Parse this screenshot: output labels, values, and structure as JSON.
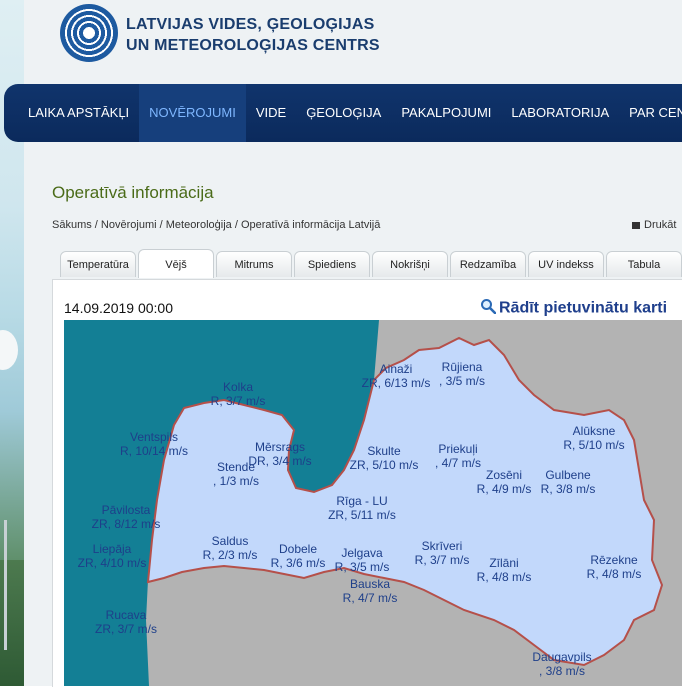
{
  "header": {
    "org_line1": "LATVIJAS VIDES, ĢEOLOĢIJAS",
    "org_line2": "UN METEOROLOĢIJAS CENTRS"
  },
  "nav": {
    "items": [
      {
        "label": "LAIKA APSTĀKĻI",
        "active": false
      },
      {
        "label": "NOVĒROJUMI",
        "active": true
      },
      {
        "label": "VIDE",
        "active": false
      },
      {
        "label": "ĢEOLOĢIJA",
        "active": false
      },
      {
        "label": "PAKALPOJUMI",
        "active": false
      },
      {
        "label": "LABORATORIJA",
        "active": false
      },
      {
        "label": "PAR CENTRU",
        "active": false
      }
    ]
  },
  "page": {
    "title": "Operatīvā informācija",
    "breadcrumb": [
      "Sākums",
      "Novērojumi",
      "Meteoroloģija",
      "Operatīvā informācija Latvijā"
    ],
    "breadcrumb_sep": " / ",
    "print_label": "Drukāt"
  },
  "tabs": [
    {
      "label": "Temperatūra",
      "active": false
    },
    {
      "label": "Vējš",
      "active": true
    },
    {
      "label": "Mitrums",
      "active": false
    },
    {
      "label": "Spiediens",
      "active": false
    },
    {
      "label": "Nokrišņi",
      "active": false
    },
    {
      "label": "Redzamība",
      "active": false
    },
    {
      "label": "UV indekss",
      "active": false
    },
    {
      "label": "Tabula",
      "active": false
    }
  ],
  "map_panel": {
    "date": "14.09.2019 00:00",
    "zoom_link": "Rādīt pietuvinātu karti",
    "icon": "magnifier-icon",
    "colors": {
      "sea": "#137f95",
      "land": "#c2d8fb",
      "neighbor": "#b3b3b3",
      "border": "#b5504a",
      "station_text": "#1e3f8a"
    }
  },
  "stations": [
    {
      "name": "Ainaži",
      "wind": "ZR, 6/13 m/s"
    },
    {
      "name": "Rūjiena",
      "wind": ", 3/5 m/s"
    },
    {
      "name": "Kolka",
      "wind": "R, 3/7 m/s"
    },
    {
      "name": "Ventspils",
      "wind": "R, 10/14 m/s"
    },
    {
      "name": "Mērsrags",
      "wind": "DR, 3/4 m/s"
    },
    {
      "name": "Stende",
      "wind": ", 1/3 m/s"
    },
    {
      "name": "Skulte",
      "wind": "ZR, 5/10 m/s"
    },
    {
      "name": "Priekuļi",
      "wind": ", 4/7 m/s"
    },
    {
      "name": "Alūksne",
      "wind": "R, 5/10 m/s"
    },
    {
      "name": "Zosēni",
      "wind": "R, 4/9 m/s"
    },
    {
      "name": "Gulbene",
      "wind": "R, 3/8 m/s"
    },
    {
      "name": "Pāvilosta",
      "wind": "ZR, 8/12 m/s"
    },
    {
      "name": "Rīga - LU",
      "wind": "ZR, 5/11 m/s"
    },
    {
      "name": "Liepāja",
      "wind": "ZR, 4/10 m/s"
    },
    {
      "name": "Saldus",
      "wind": "R, 2/3 m/s"
    },
    {
      "name": "Dobele",
      "wind": "R, 3/6 m/s"
    },
    {
      "name": "Jelgava",
      "wind": "R, 3/5 m/s"
    },
    {
      "name": "Skrīveri",
      "wind": "R, 3/7 m/s"
    },
    {
      "name": "Zīlāni",
      "wind": "R, 4/8 m/s"
    },
    {
      "name": "Rēzekne",
      "wind": "R, 4/8 m/s"
    },
    {
      "name": "Bauska",
      "wind": "R, 4/7 m/s"
    },
    {
      "name": "Rucava",
      "wind": "ZR, 3/7 m/s"
    },
    {
      "name": "Daugavpils",
      "wind": ", 3/8 m/s"
    }
  ]
}
